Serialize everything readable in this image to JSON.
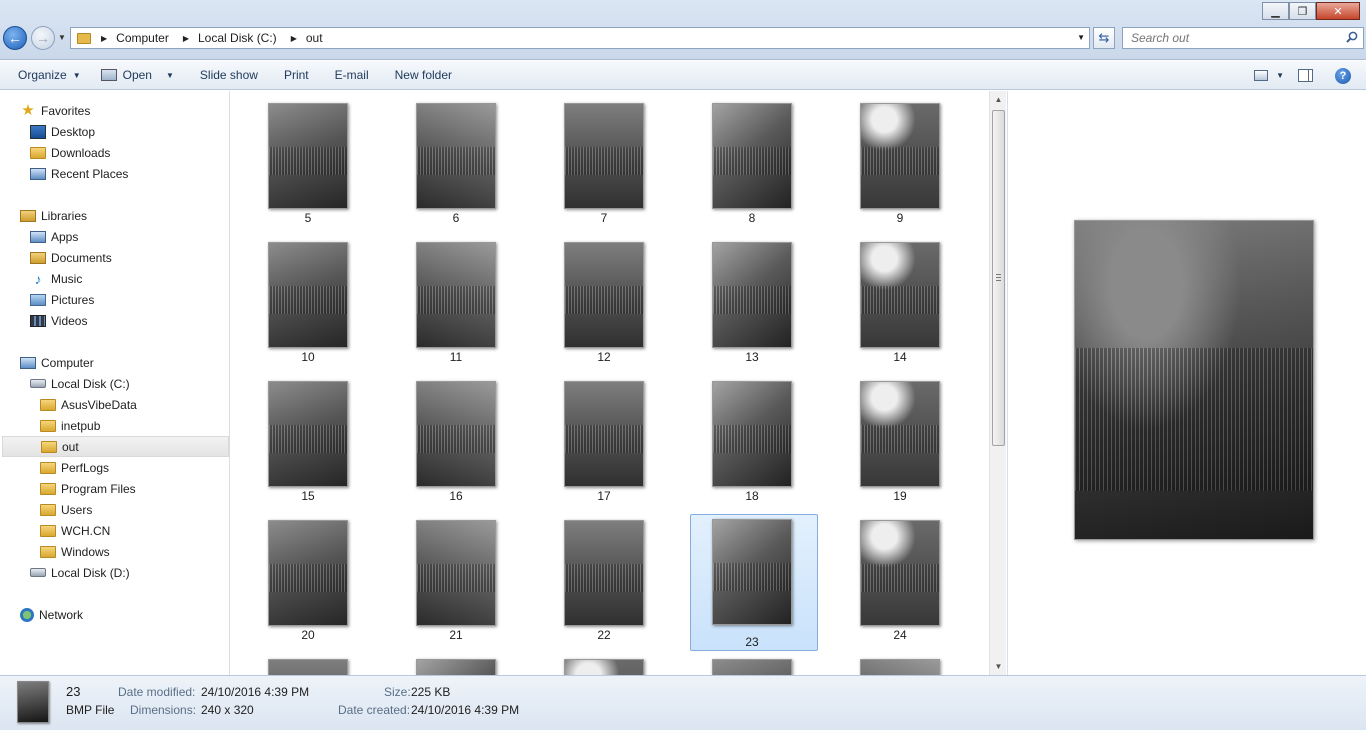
{
  "window": {
    "minimize_glyph": "▁",
    "maximize_glyph": "❐",
    "close_glyph": "✕"
  },
  "address_bar": {
    "crumbs": [
      "Computer",
      "Local Disk (C:)",
      "out"
    ],
    "search_placeholder": "Search out"
  },
  "toolbar": {
    "organize": "Organize",
    "open": "Open",
    "slide_show": "Slide show",
    "print": "Print",
    "email": "E-mail",
    "new_folder": "New folder"
  },
  "nav": {
    "favorites": {
      "label": "Favorites",
      "items": [
        "Desktop",
        "Downloads",
        "Recent Places"
      ]
    },
    "libraries": {
      "label": "Libraries",
      "items": [
        "Apps",
        "Documents",
        "Music",
        "Pictures",
        "Videos"
      ]
    },
    "computer": {
      "label": "Computer",
      "drive_c": "Local Disk (C:)",
      "folders": [
        "AsusVibeData",
        "inetpub",
        "out",
        "PerfLogs",
        "Program Files",
        "Users",
        "WCH.CN",
        "Windows"
      ],
      "selected_folder": "out",
      "drive_d": "Local Disk (D:)"
    },
    "network": "Network"
  },
  "files": [
    {
      "name": "5"
    },
    {
      "name": "6"
    },
    {
      "name": "7"
    },
    {
      "name": "8"
    },
    {
      "name": "9"
    },
    {
      "name": "10"
    },
    {
      "name": "11"
    },
    {
      "name": "12"
    },
    {
      "name": "13"
    },
    {
      "name": "14"
    },
    {
      "name": "15"
    },
    {
      "name": "16"
    },
    {
      "name": "17"
    },
    {
      "name": "18"
    },
    {
      "name": "19"
    },
    {
      "name": "20"
    },
    {
      "name": "21"
    },
    {
      "name": "22"
    },
    {
      "name": "23"
    },
    {
      "name": "24"
    }
  ],
  "selected_file": "23",
  "details": {
    "name": "23",
    "type": "BMP File",
    "date_modified_label": "Date modified:",
    "date_modified": "24/10/2016 4:39 PM",
    "dimensions_label": "Dimensions:",
    "dimensions": "240 x 320",
    "size_label": "Size:",
    "size": "225 KB",
    "date_created_label": "Date created:",
    "date_created": "24/10/2016 4:39 PM"
  }
}
